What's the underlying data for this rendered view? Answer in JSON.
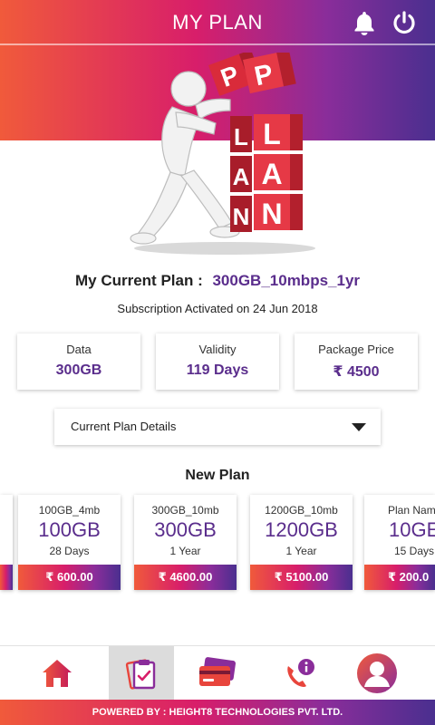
{
  "header": {
    "title": "MY PLAN"
  },
  "hero": {
    "cube_letters": [
      "P",
      "L",
      "A",
      "N",
      "P",
      "L",
      "A",
      "N"
    ]
  },
  "current_plan": {
    "label": "My Current Plan :",
    "name": "300GB_10mbps_1yr",
    "subscription": "Subscription Activated on 24 Jun 2018",
    "stats": [
      {
        "label": "Data",
        "value": "300GB"
      },
      {
        "label": "Validity",
        "value": "119 Days"
      },
      {
        "label": "Package Price",
        "value": "₹ 4500"
      }
    ],
    "details_label": "Current Plan Details"
  },
  "new_plan": {
    "title": "New Plan",
    "cards": [
      {
        "name": "100GB_4mb",
        "data": "100GB",
        "duration": "28 Days",
        "price": "₹ 600.00"
      },
      {
        "name": "300GB_10mb",
        "data": "300GB",
        "duration": "1 Year",
        "price": "₹ 4600.00"
      },
      {
        "name": "1200GB_10mb",
        "data": "1200GB",
        "duration": "1 Year",
        "price": "₹ 5100.00"
      },
      {
        "name": "Plan Nam",
        "data": "10GE",
        "duration": "15 Days",
        "price": "₹ 200.0"
      }
    ]
  },
  "bottom_nav": {
    "items": [
      {
        "id": "home",
        "icon": "home-icon"
      },
      {
        "id": "plans",
        "icon": "clipboard-icon",
        "active": true
      },
      {
        "id": "payments",
        "icon": "cards-icon"
      },
      {
        "id": "support",
        "icon": "phone-info-icon"
      },
      {
        "id": "profile",
        "icon": "profile-icon"
      }
    ]
  },
  "footer": {
    "text": "POWERED BY : HEIGHT8 TECHNOLOGIES PVT. LTD."
  },
  "colors": {
    "gradient_start": "#f05a3b",
    "gradient_mid": "#d81e6a",
    "gradient_end": "#4a2f8f",
    "accent": "#5a2d8c"
  }
}
